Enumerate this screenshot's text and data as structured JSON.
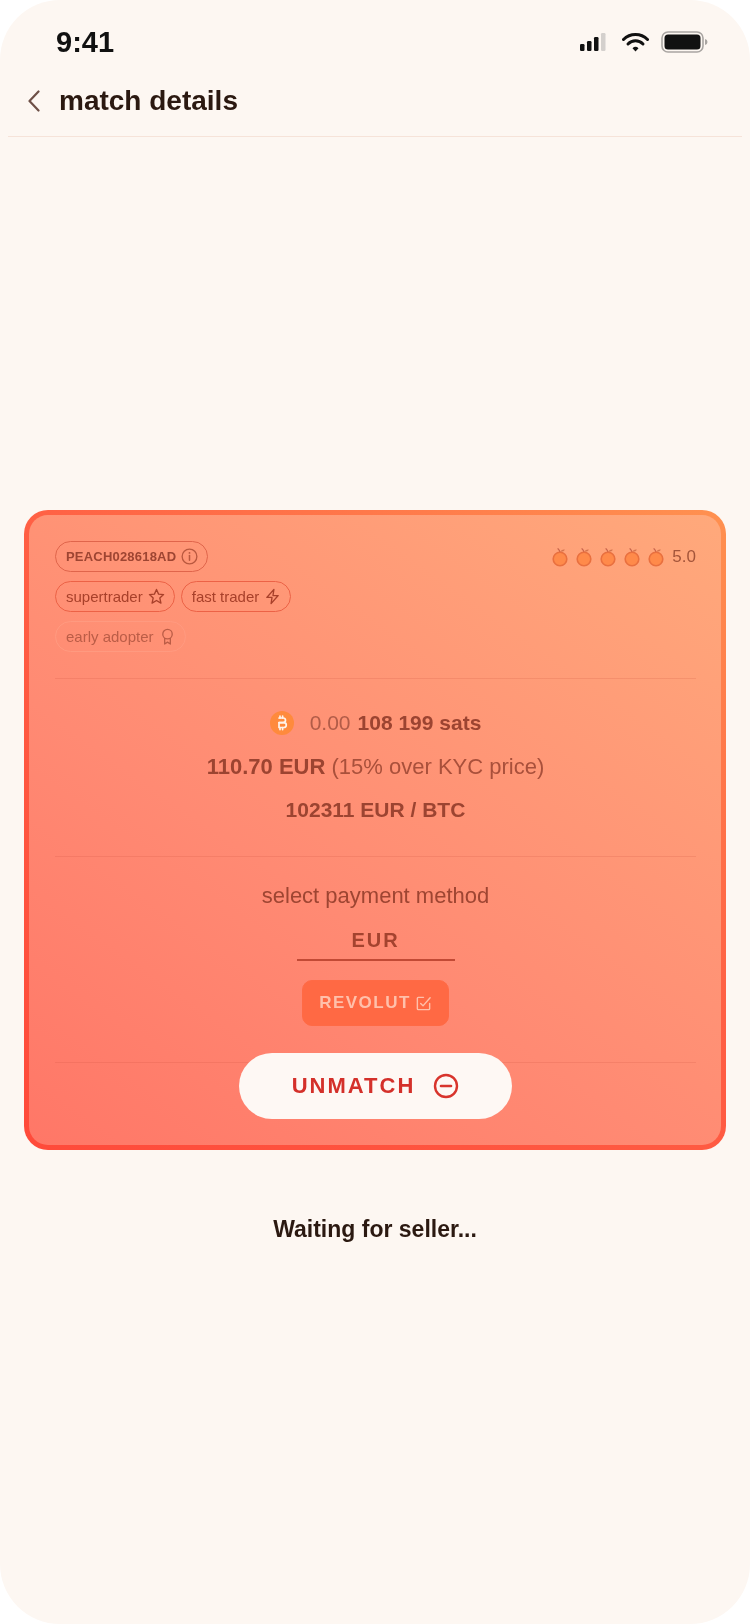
{
  "status_bar": {
    "time": "9:41"
  },
  "header": {
    "title": "match details"
  },
  "match_card": {
    "trader": {
      "id": "PEACH028618AD",
      "stars": 5,
      "rating": "5.0",
      "badges": [
        {
          "label": "supertrader",
          "kind": "star",
          "earned": true
        },
        {
          "label": "fast trader",
          "kind": "bolt",
          "earned": true
        },
        {
          "label": "early adopter",
          "kind": "ribbon",
          "earned": false
        }
      ]
    },
    "amount": {
      "btc": "0.00",
      "sats": "108 199 sats"
    },
    "price": "**110.70 EUR** (15% over KYC price)",
    "rate": "102311 EUR / BTC",
    "payment": {
      "prompt": "select payment method",
      "currencies": [
        {
          "label": "EUR",
          "selected": true
        }
      ],
      "methods": [
        {
          "label": "REVOLUT",
          "selected": true
        }
      ]
    },
    "unmatch_button": "UNMATCH"
  },
  "status_message": "Waiting for seller..."
}
